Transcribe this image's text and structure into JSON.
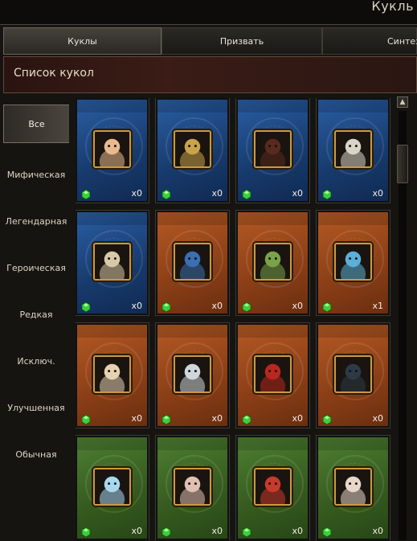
{
  "window": {
    "title": "Кукль"
  },
  "tabs": [
    {
      "label": "Куклы",
      "active": true
    },
    {
      "label": "Призвать",
      "active": false
    },
    {
      "label": "Синтез",
      "active": false
    }
  ],
  "list_header": {
    "title": "Список кукол"
  },
  "categories": [
    {
      "label": "Все",
      "active": true
    },
    {
      "label": "Мифическая"
    },
    {
      "label": "Легендарная"
    },
    {
      "label": "Героическая"
    },
    {
      "label": "Редкая"
    },
    {
      "label": "Исключ."
    },
    {
      "label": "Улучшенная"
    },
    {
      "label": "Обычная"
    }
  ],
  "colors": {
    "blue": "#1d4a86",
    "orange": "#9c4a1c",
    "green": "#3f6a26",
    "gem": "#39d13a",
    "frame_gold": "#c99b3e"
  },
  "dolls": [
    {
      "rarity": "blue",
      "count": "x0",
      "icon": "female-warrior-portrait"
    },
    {
      "rarity": "blue",
      "count": "x0",
      "icon": "golden-armor-portrait"
    },
    {
      "rarity": "blue",
      "count": "x0",
      "icon": "dark-knight-portrait"
    },
    {
      "rarity": "blue",
      "count": "x0",
      "icon": "skeleton-king-portrait"
    },
    {
      "rarity": "blue",
      "count": "x0",
      "icon": "winged-emblem-portrait"
    },
    {
      "rarity": "orange",
      "count": "x0",
      "icon": "blue-dragon-portrait"
    },
    {
      "rarity": "orange",
      "count": "x0",
      "icon": "frog-portrait"
    },
    {
      "rarity": "orange",
      "count": "x1",
      "icon": "blue-ogre-portrait"
    },
    {
      "rarity": "orange",
      "count": "x0",
      "icon": "dwarf-portrait"
    },
    {
      "rarity": "orange",
      "count": "x0",
      "icon": "white-wizard-portrait"
    },
    {
      "rarity": "orange",
      "count": "x0",
      "icon": "red-mage-portrait"
    },
    {
      "rarity": "orange",
      "count": "x0",
      "icon": "dark-armor-portrait"
    },
    {
      "rarity": "green",
      "count": "x0",
      "icon": "blue-haired-girl-portrait"
    },
    {
      "rarity": "green",
      "count": "x0",
      "icon": "bandit-portrait"
    },
    {
      "rarity": "green",
      "count": "x0",
      "icon": "red-warrior-portrait"
    },
    {
      "rarity": "green",
      "count": "x0",
      "icon": "old-sage-portrait"
    }
  ]
}
